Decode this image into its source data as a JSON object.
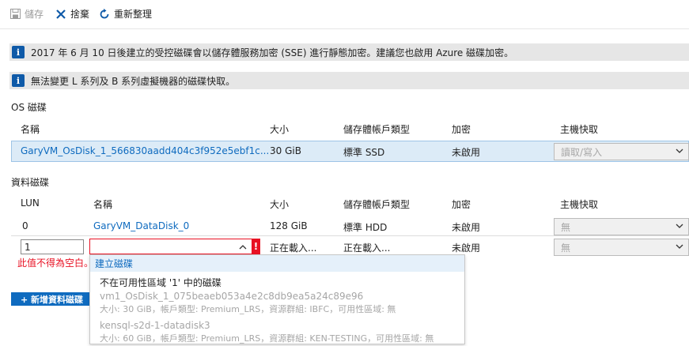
{
  "toolbar": {
    "save_label": "儲存",
    "discard_label": "捨棄",
    "refresh_label": "重新整理"
  },
  "notices": [
    "2017 年 6 月 10 日後建立的受控磁碟會以儲存體服務加密 (SSE) 進行靜態加密。建議您也啟用 Azure 磁碟加密。",
    "無法變更 L 系列及 B 系列虛擬機器的磁碟快取。"
  ],
  "os_disk": {
    "section_title": "OS 磁碟",
    "headers": {
      "name": "名稱",
      "size": "大小",
      "storage_type": "儲存體帳戶類型",
      "encryption": "加密",
      "host_cache": "主機快取"
    },
    "row": {
      "name": "GaryVM_OsDisk_1_566830aadd404c3f952e5ebf1c...",
      "size": "30 GiB",
      "storage_type": "標準 SSD",
      "encryption": "未啟用",
      "host_cache": "讀取/寫入"
    }
  },
  "data_disks": {
    "section_title": "資料磁碟",
    "headers": {
      "lun": "LUN",
      "name": "名稱",
      "size": "大小",
      "storage_type": "儲存體帳戶類型",
      "encryption": "加密",
      "host_cache": "主機快取"
    },
    "rows": [
      {
        "lun": "0",
        "name": "GaryVM_DataDisk_0",
        "size": "128 GiB",
        "storage_type": "標準 HDD",
        "encryption": "未啟用",
        "host_cache": "無"
      },
      {
        "lun": "1",
        "name": "",
        "size": "正在載入...",
        "storage_type": "正在載入...",
        "encryption": "未啟用",
        "host_cache": "無"
      }
    ],
    "error_badge": "!",
    "error_message": "此值不得為空白。",
    "add_button": "+ 新增資料磁碟"
  },
  "dropdown": {
    "create_label": "建立磁碟",
    "group_header": "不在可用性區域 '1' 中的磁碟",
    "items": [
      {
        "name": "vm1_OsDisk_1_075beaeb053a4e2c8db9ea5a24c89e96",
        "details": "大小: 30 GiB，帳戶類型: Premium_LRS，資源群組: IBFC，可用性區域: 無"
      },
      {
        "name": "kensql-s2d-1-datadisk3",
        "details": "大小: 60 GiB，帳戶類型: Premium_LRS，資源群組: KEN-TESTING，可用性區域: 無"
      }
    ]
  },
  "colors": {
    "accent": "#0f6bbf",
    "error": "#e81123",
    "info_bar_bg": "#e6e6e6",
    "selected_row_bg": "#dcebf7"
  }
}
